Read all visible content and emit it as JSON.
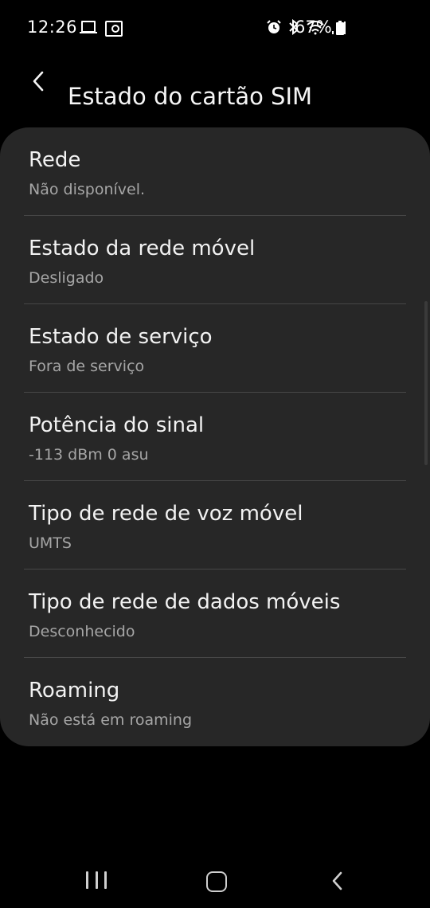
{
  "status_bar": {
    "time": "12:26",
    "battery": "67%",
    "icons": [
      "laptop-icon",
      "radio-icon",
      "alarm-icon",
      "bluetooth-icon",
      "wifi-icon",
      "signal-icon",
      "battery-icon"
    ]
  },
  "header": {
    "back_icon": "chevron-left-icon",
    "title": "Estado do cartão SIM"
  },
  "items": [
    {
      "title": "Rede",
      "subtitle": "Não disponível."
    },
    {
      "title": "Estado da rede móvel",
      "subtitle": "Desligado"
    },
    {
      "title": "Estado de serviço",
      "subtitle": "Fora de serviço"
    },
    {
      "title": "Potência do sinal",
      "subtitle": "-113 dBm 0 asu"
    },
    {
      "title": "Tipo de rede de voz móvel",
      "subtitle": "UMTS"
    },
    {
      "title": "Tipo de rede de dados móveis",
      "subtitle": "Desconhecido"
    },
    {
      "title": "Roaming",
      "subtitle": "Não está em roaming"
    }
  ],
  "nav_bar": {
    "icons": [
      "recent-apps-icon",
      "home-icon",
      "back-icon"
    ]
  },
  "colors": {
    "background": "#000000",
    "card": "#272727",
    "title_text": "#f2f2f2",
    "subtitle_text": "#a6a6a6",
    "divider": "#474747"
  }
}
